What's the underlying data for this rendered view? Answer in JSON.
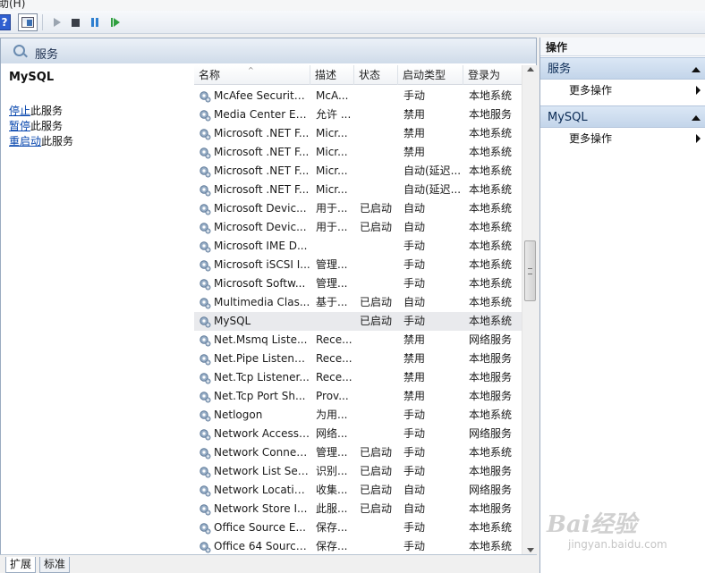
{
  "menubar": {
    "help_menu": "助(H)"
  },
  "toolbar": {
    "help_glyph": "?"
  },
  "content": {
    "header_title": "服务",
    "left": {
      "service_name": "MySQL",
      "actions": [
        {
          "link": "停止",
          "rest": "此服务"
        },
        {
          "link": "暂停",
          "rest": "此服务"
        },
        {
          "link": "重启动",
          "rest": "此服务"
        }
      ]
    },
    "columns": [
      "名称",
      "描述",
      "状态",
      "启动类型",
      "登录为"
    ],
    "rows": [
      {
        "name": "McAfee Security ...",
        "desc": "McA...",
        "status": "",
        "startup": "手动",
        "logon": "本地系统"
      },
      {
        "name": "Media Center Ex...",
        "desc": "允许 ...",
        "status": "",
        "startup": "禁用",
        "logon": "本地服务"
      },
      {
        "name": "Microsoft .NET F...",
        "desc": "Micr...",
        "status": "",
        "startup": "禁用",
        "logon": "本地系统"
      },
      {
        "name": "Microsoft .NET F...",
        "desc": "Micr...",
        "status": "",
        "startup": "禁用",
        "logon": "本地系统"
      },
      {
        "name": "Microsoft .NET F...",
        "desc": "Micr...",
        "status": "",
        "startup": "自动(延迟...",
        "logon": "本地系统"
      },
      {
        "name": "Microsoft .NET F...",
        "desc": "Micr...",
        "status": "",
        "startup": "自动(延迟...",
        "logon": "本地系统"
      },
      {
        "name": "Microsoft Devic...",
        "desc": "用于...",
        "status": "已启动",
        "startup": "自动",
        "logon": "本地系统"
      },
      {
        "name": "Microsoft Devic...",
        "desc": "用于...",
        "status": "已启动",
        "startup": "自动",
        "logon": "本地系统"
      },
      {
        "name": "Microsoft IME D...",
        "desc": "",
        "status": "",
        "startup": "手动",
        "logon": "本地系统"
      },
      {
        "name": "Microsoft iSCSI I...",
        "desc": "管理...",
        "status": "",
        "startup": "手动",
        "logon": "本地系统"
      },
      {
        "name": "Microsoft Softw...",
        "desc": "管理...",
        "status": "",
        "startup": "手动",
        "logon": "本地系统"
      },
      {
        "name": "Multimedia Clas...",
        "desc": "基于...",
        "status": "已启动",
        "startup": "自动",
        "logon": "本地系统"
      },
      {
        "name": "MySQL",
        "desc": "",
        "status": "已启动",
        "startup": "手动",
        "logon": "本地系统",
        "selected": true
      },
      {
        "name": "Net.Msmq Liste...",
        "desc": "Rece...",
        "status": "",
        "startup": "禁用",
        "logon": "网络服务"
      },
      {
        "name": "Net.Pipe Listene...",
        "desc": "Rece...",
        "status": "",
        "startup": "禁用",
        "logon": "本地服务"
      },
      {
        "name": "Net.Tcp Listener...",
        "desc": "Rece...",
        "status": "",
        "startup": "禁用",
        "logon": "本地服务"
      },
      {
        "name": "Net.Tcp Port Sh...",
        "desc": "Prov...",
        "status": "",
        "startup": "禁用",
        "logon": "本地服务"
      },
      {
        "name": "Netlogon",
        "desc": "为用...",
        "status": "",
        "startup": "手动",
        "logon": "本地系统"
      },
      {
        "name": "Network Access ...",
        "desc": "网络...",
        "status": "",
        "startup": "手动",
        "logon": "网络服务"
      },
      {
        "name": "Network Connec...",
        "desc": "管理...",
        "status": "已启动",
        "startup": "手动",
        "logon": "本地系统"
      },
      {
        "name": "Network List Ser...",
        "desc": "识别...",
        "status": "已启动",
        "startup": "手动",
        "logon": "本地服务"
      },
      {
        "name": "Network Locatio...",
        "desc": "收集...",
        "status": "已启动",
        "startup": "自动",
        "logon": "网络服务"
      },
      {
        "name": "Network Store I...",
        "desc": "此服...",
        "status": "已启动",
        "startup": "自动",
        "logon": "本地服务"
      },
      {
        "name": "Office  Source E...",
        "desc": "保存...",
        "status": "",
        "startup": "手动",
        "logon": "本地系统"
      },
      {
        "name": "Office 64 Source...",
        "desc": "保存...",
        "status": "",
        "startup": "手动",
        "logon": "本地系统"
      }
    ]
  },
  "tabs": [
    "扩展",
    "标准"
  ],
  "actions_pane": {
    "title": "操作",
    "groups": [
      {
        "label": "服务",
        "item": "更多操作"
      },
      {
        "label": "MySQL",
        "item": "更多操作"
      }
    ]
  },
  "watermark": {
    "brand": "Bai经验",
    "url": "jingyan.baidu.com"
  },
  "colors": {
    "selected_row": "#e9eaed",
    "group_header": "#c3d5ea",
    "link": "#0645ad"
  }
}
